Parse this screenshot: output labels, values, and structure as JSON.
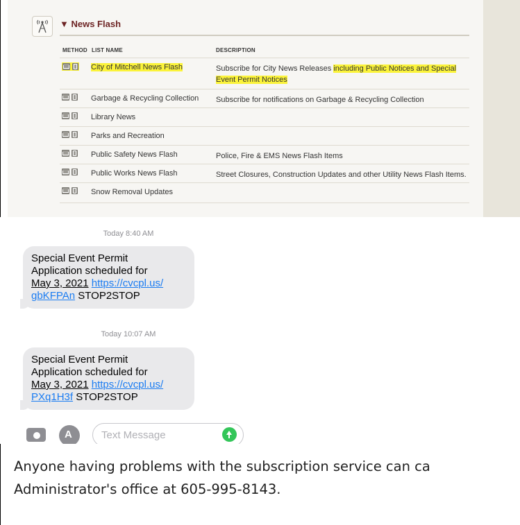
{
  "newsflash": {
    "section_title": "▼ News Flash",
    "col_method": "METHOD",
    "col_list_name": "LIST NAME",
    "col_description": "DESCRIPTION",
    "rows": [
      {
        "name": "City of Mitchell News Flash",
        "desc_plain": "Subscribe for City News Releases ",
        "desc_highlight": "including Public Notices and Special Event Permit Notices",
        "name_highlighted": true
      },
      {
        "name": "Garbage & Recycling Collection",
        "desc_plain": "Subscribe for notifications on Garbage & Recycling Collection",
        "desc_highlight": ""
      },
      {
        "name": "Library News",
        "desc_plain": "",
        "desc_highlight": ""
      },
      {
        "name": "Parks and Recreation",
        "desc_plain": "",
        "desc_highlight": ""
      },
      {
        "name": "Public Safety News Flash",
        "desc_plain": "Police, Fire & EMS News Flash Items",
        "desc_highlight": ""
      },
      {
        "name": "Public Works News Flash",
        "desc_plain": "Street Closures, Construction Updates and other Utility News Flash Items.",
        "desc_highlight": ""
      },
      {
        "name": "Snow Removal Updates",
        "desc_plain": "",
        "desc_highlight": ""
      }
    ],
    "highlight_color": "#fbf33a",
    "title_color": "#6d2424"
  },
  "messages": {
    "thread": [
      {
        "time_label": "Today",
        "time": "8:40 AM",
        "line1": "Special Event Permit",
        "line2": "Application scheduled for",
        "date": "May 3, 2021",
        "link1": "https://cvcpl.us/",
        "link2": "gbKFPAn",
        "suffix": "STOP2STOP"
      },
      {
        "time_label": "Today",
        "time": "10:07 AM",
        "line1": "Special Event Permit",
        "line2": "Application scheduled for",
        "date": "May 3, 2021",
        "link1": "https://cvcpl.us/",
        "link2": "PXq1H3f",
        "suffix": "STOP2STOP"
      }
    ],
    "composer_placeholder": "Text Message",
    "icons": [
      "camera-icon",
      "app-store-icon",
      "send-icon"
    ],
    "link_color": "#1a7cf2",
    "send_color": "#33c659"
  },
  "document": {
    "line1": "Anyone having problems with the subscription service can ca",
    "line2": "Administrator's office at 605-995-8143."
  }
}
